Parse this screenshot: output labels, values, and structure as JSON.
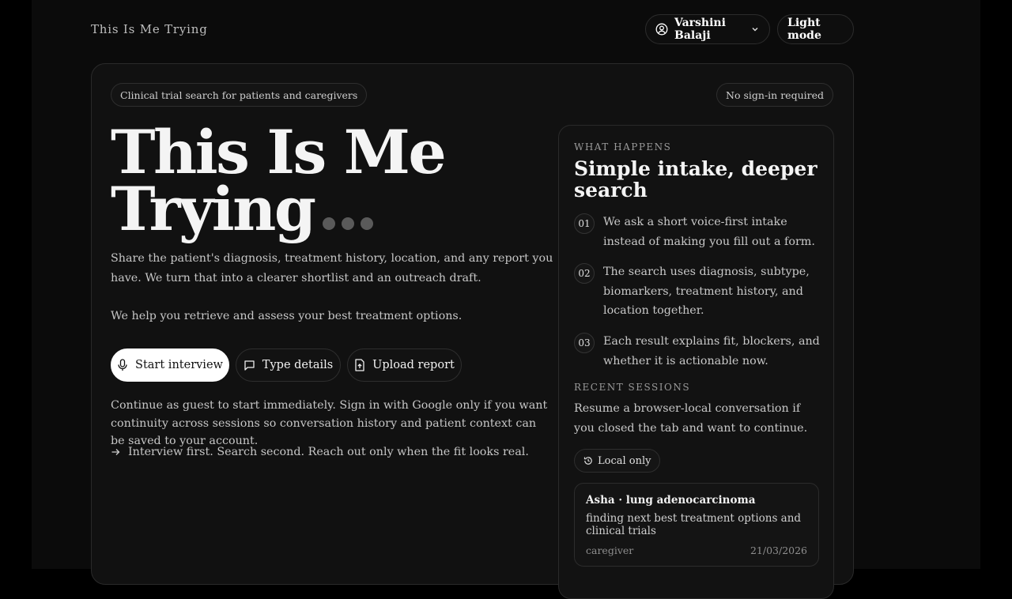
{
  "header": {
    "brand": "This Is Me Trying",
    "user_name": "Varshini Balaji",
    "mode_label": "Light mode"
  },
  "hero": {
    "tag_left": "Clinical trial search for patients and caregivers",
    "tag_right": "No sign-in required",
    "title_line1": "This Is Me",
    "title_line2": "Trying",
    "description1": "Share the patient's diagnosis, treatment history, location, and any report you have. We turn that into a clearer shortlist and an outreach draft.",
    "description2": "We help you retrieve and assess your best treatment options.",
    "buttons": {
      "start": "Start interview",
      "type": "Type details",
      "upload": "Upload report"
    },
    "guest_note": "Continue as guest to start immediately. Sign in with Google only if you want continuity across sessions so conversation history and patient context can be saved to your account.",
    "motto": "Interview first. Search second. Reach out only when the fit looks real."
  },
  "panel": {
    "eyebrow": "WHAT HAPPENS",
    "title": "Simple intake, deeper search",
    "steps": [
      {
        "num": "01",
        "text": "We ask a short voice-first intake instead of making you fill out a form."
      },
      {
        "num": "02",
        "text": "The search uses diagnosis, subtype, biomarkers, treatment history, and location together."
      },
      {
        "num": "03",
        "text": "Each result explains fit, blockers, and whether it is actionable now."
      }
    ],
    "recent_eyebrow": "RECENT SESSIONS",
    "recent_desc": "Resume a browser-local conversation if you closed the tab and want to continue.",
    "local_label": "Local only",
    "session": {
      "title": "Asha · lung adenocarcinoma",
      "desc": "finding next best treatment options and clinical trials",
      "role": "caregiver",
      "date": "21/03/2026"
    }
  },
  "icons": [
    "user-circle-icon",
    "chevron-down-icon",
    "microphone-icon",
    "message-icon",
    "file-upload-icon",
    "arrow-right-icon",
    "history-icon"
  ]
}
